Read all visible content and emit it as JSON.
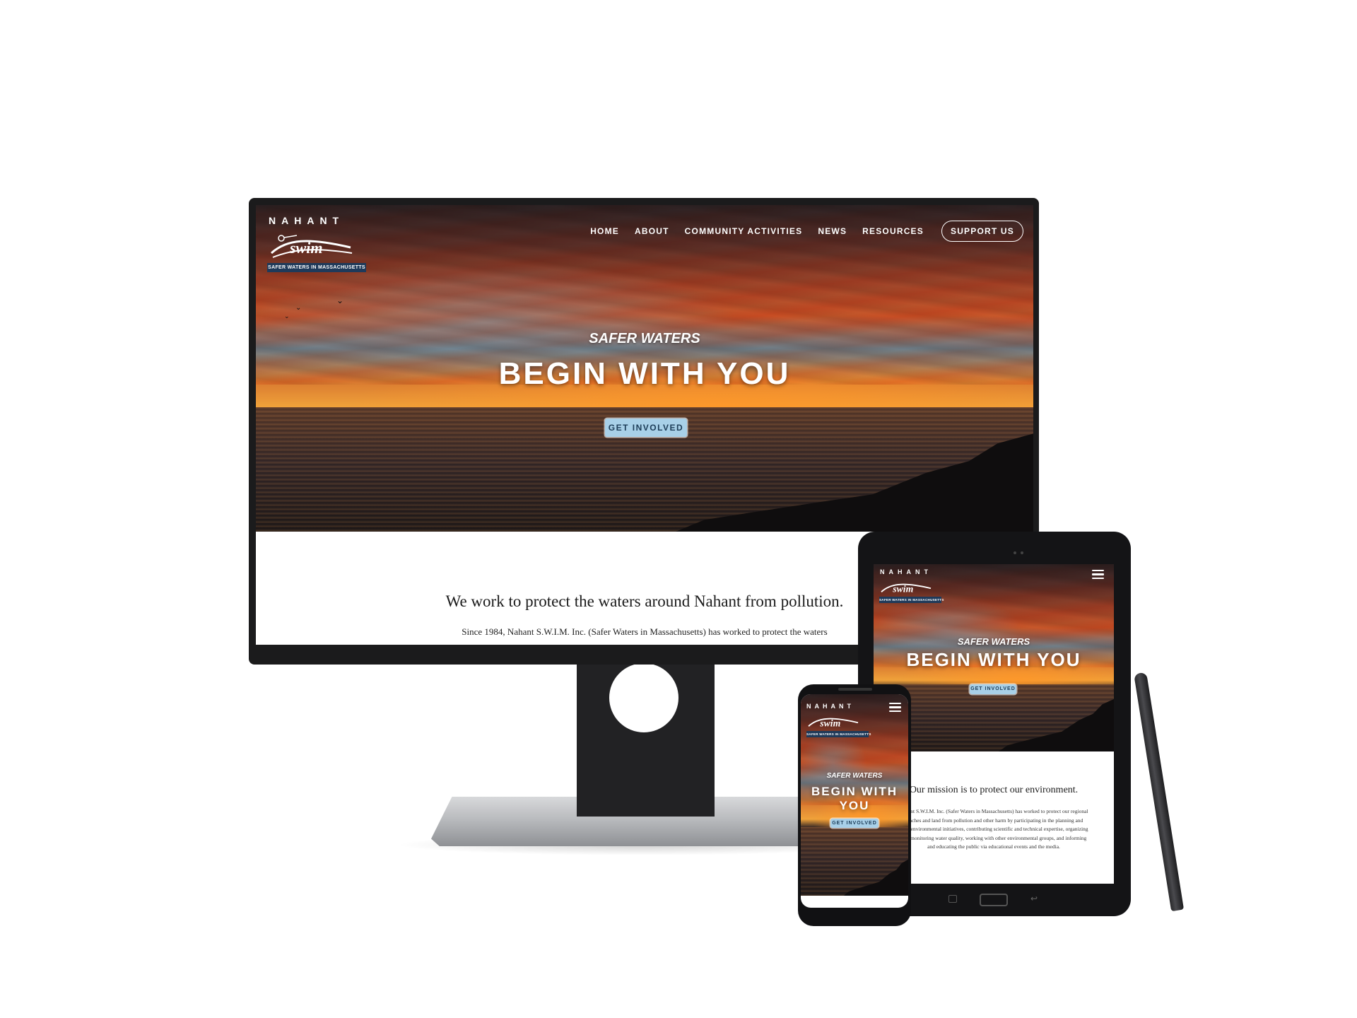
{
  "site": {
    "logo_word": "NAHANT",
    "logo_tagline": "SAFER WATERS IN MASSACHUSETTS"
  },
  "nav": {
    "items": [
      {
        "label": "HOME"
      },
      {
        "label": "ABOUT"
      },
      {
        "label": "COMMUNITY ACTIVITIES"
      },
      {
        "label": "NEWS"
      },
      {
        "label": "RESOURCES"
      }
    ],
    "support_label": "SUPPORT US"
  },
  "hero": {
    "kicker": "SAFER WATERS",
    "title": "BEGIN WITH YOU",
    "title_phone_line1": "BEGIN WITH",
    "title_phone_line2": "YOU",
    "cta_label": "GET INVOLVED"
  },
  "desktop": {
    "mission": "We work to protect the waters around Nahant from pollution.",
    "body": "Since 1984, Nahant S.W.I.M. Inc. (Safer Waters in Massachusetts) has worked to protect the waters"
  },
  "tablet": {
    "mission": "Our mission is to protect our environment.",
    "body_lines": [
      "Nahant S.W.I.M. Inc. (Safer Waters in Massachusetts) has worked to protect our regional",
      "beaches and land from pollution and other harm by participating in the planning and",
      "es of environmental initiatives, contributing scientific and technical expertise, organizing",
      "ion, monitoring water quality, working with other environmental groups, and informing",
      "and educating the public via educational events and the media."
    ]
  },
  "colors": {
    "cta_background": "#a8d0e8",
    "cta_text": "#1d3d58",
    "logo_tag_background": "#1f3a5a",
    "device_frame": "#1b1b1c"
  },
  "icons": {
    "menu": "hamburger-menu-icon",
    "logo": "swim-logo-icon"
  }
}
